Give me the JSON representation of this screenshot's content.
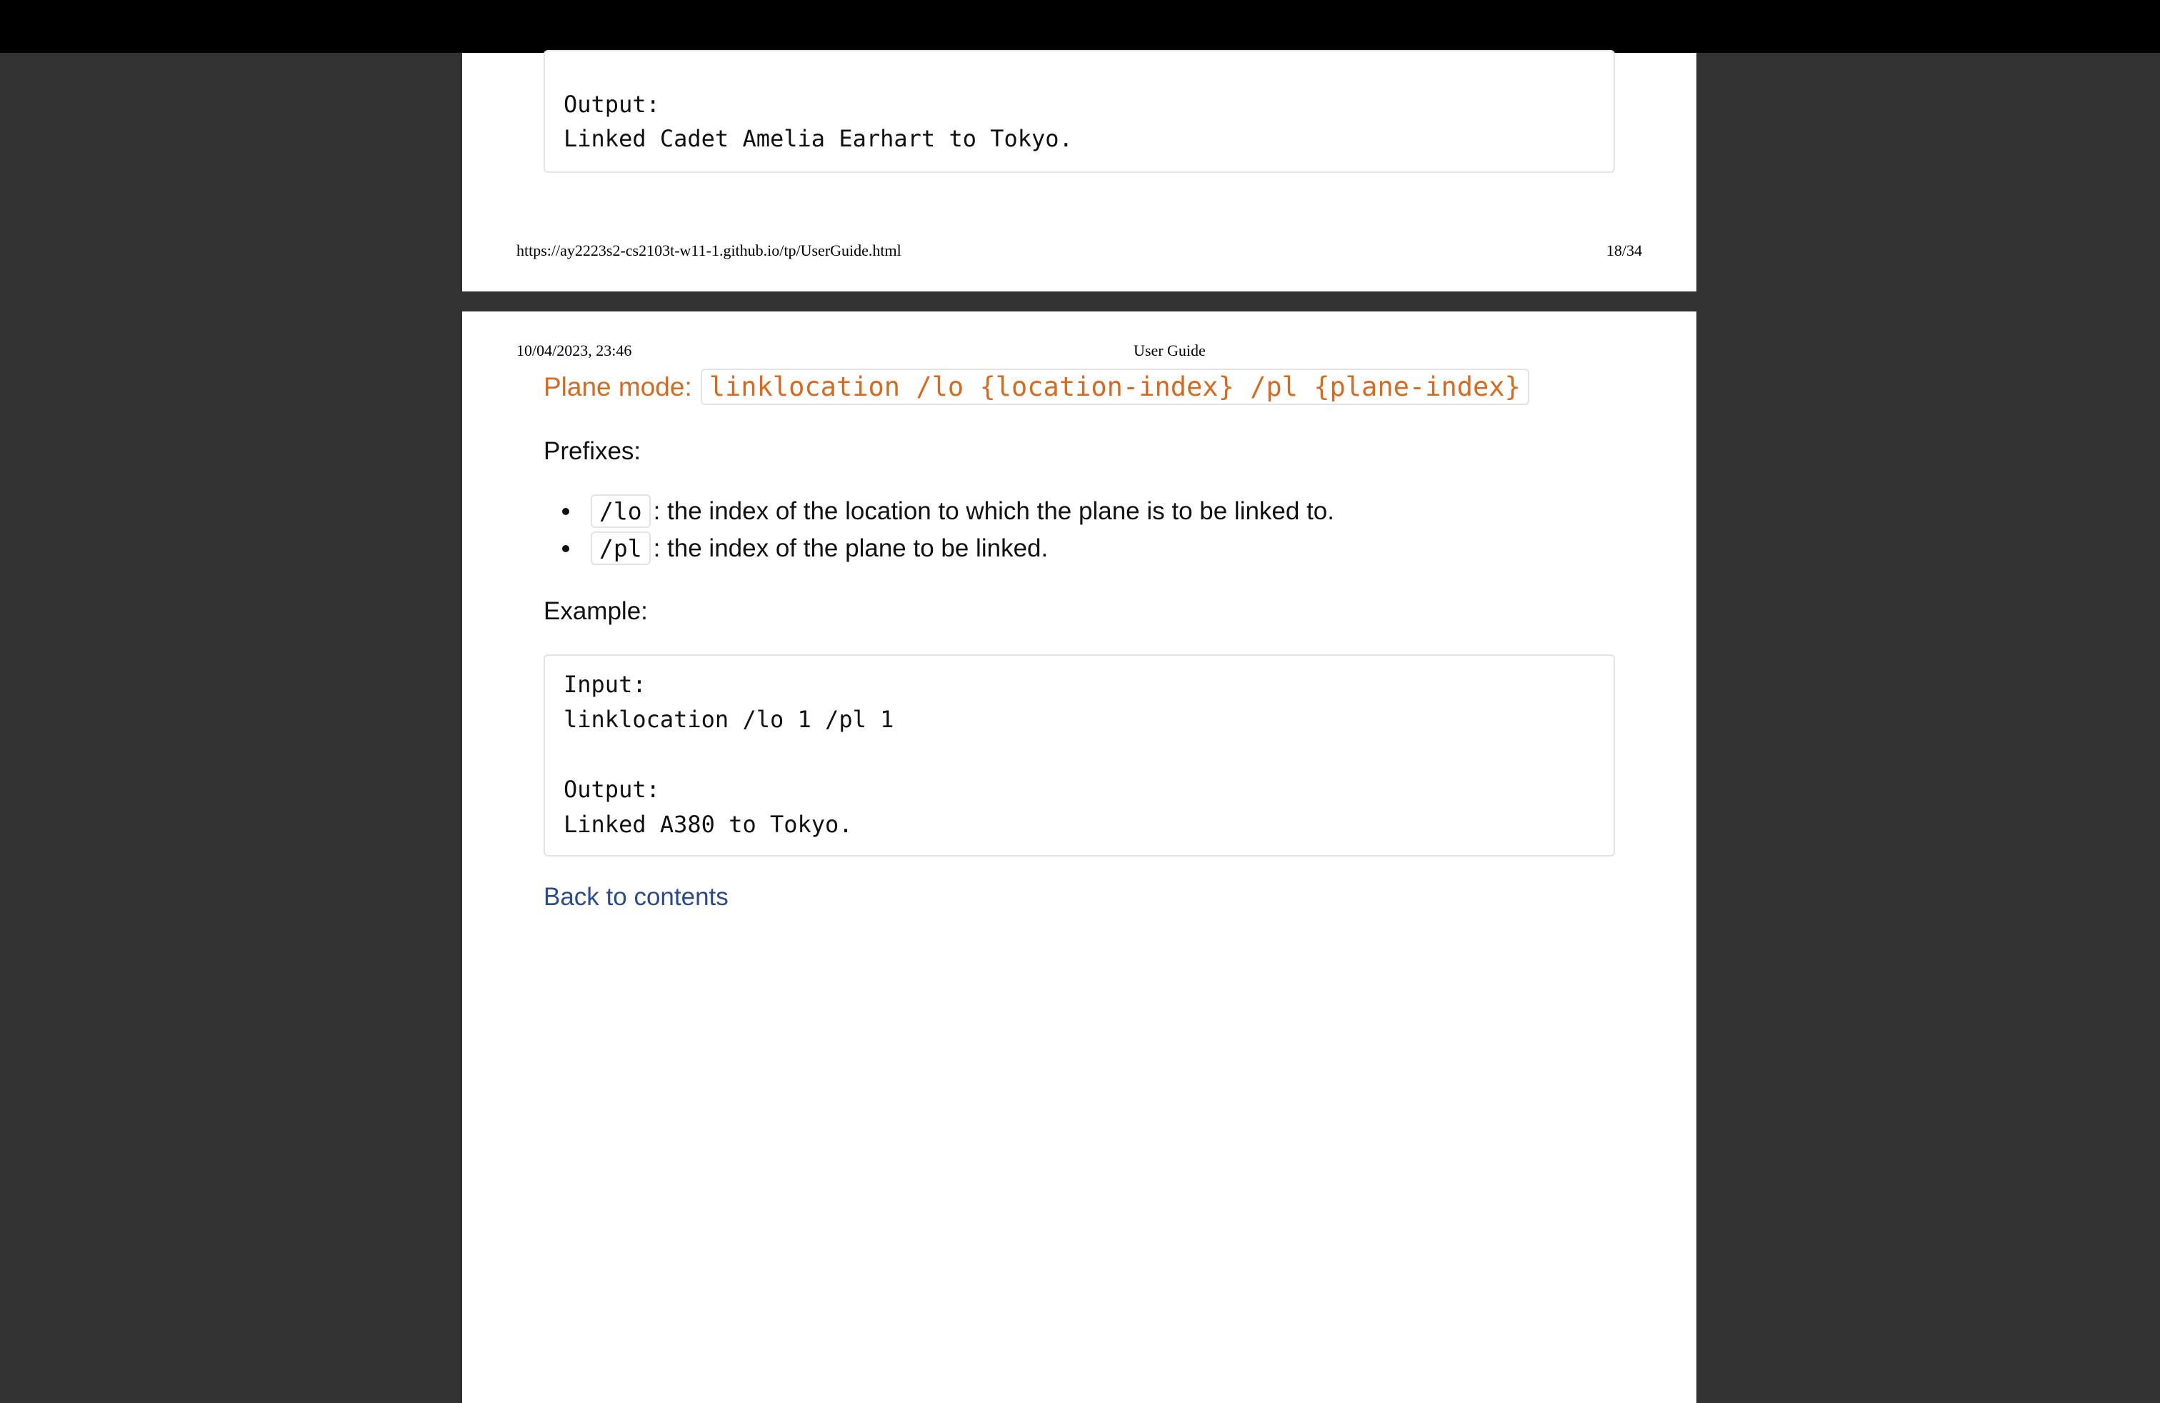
{
  "page1": {
    "code": {
      "output_label": "Output:",
      "output_text": "Linked Cadet Amelia Earhart to Tokyo."
    },
    "footer": {
      "url": "https://ay2223s2-cs2103t-w11-1.github.io/tp/UserGuide.html",
      "page": "18/34"
    }
  },
  "page2": {
    "header": {
      "date": "10/04/2023, 23:46",
      "title": "User Guide"
    },
    "heading": {
      "label": "Plane mode:",
      "command": "linklocation /lo {location-index} /pl {plane-index}"
    },
    "prefixes_label": "Prefixes:",
    "prefixes": [
      {
        "code": "/lo",
        "text": ": the index of the location to which the plane is to be linked to."
      },
      {
        "code": "/pl",
        "text": ": the index of the plane to be linked."
      }
    ],
    "example_label": "Example:",
    "example": {
      "input_label": "Input:",
      "input_text": "linklocation /lo 1 /pl 1",
      "output_label": "Output:",
      "output_text": "Linked A380 to Tokyo."
    },
    "back_link": "Back to contents"
  }
}
